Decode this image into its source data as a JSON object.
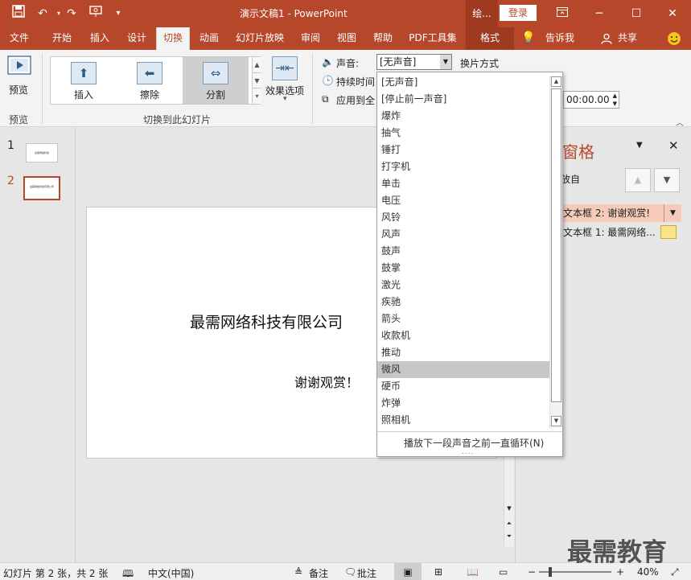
{
  "title_bar": {
    "doc_title": "演示文稿1  -  PowerPoint",
    "context_tab": "绘...",
    "login": "登录"
  },
  "tabs": [
    "文件",
    "开始",
    "插入",
    "设计",
    "切换",
    "动画",
    "幻灯片放映",
    "审阅",
    "视图",
    "帮助",
    "PDF工具集",
    "格式"
  ],
  "tell_me": "告诉我",
  "share": "共享",
  "ribbon": {
    "preview_label": "预览",
    "preview_group": "预览",
    "gallery": [
      "插入",
      "擦除",
      "分割"
    ],
    "gallery_group": "切换到此幻灯片",
    "effect_options": "效果选项",
    "sound_label": "声音:",
    "sound_value": "[无声音]",
    "duration_label": "持续时间",
    "apply_all": "应用到全",
    "advance_label": "换片方式",
    "time_value": "00:00.00"
  },
  "slides": {
    "numbers": [
      "1",
      "2"
    ],
    "thumb1_text": "最需网络科技",
    "thumb2_text": "最需网络科技有限公司"
  },
  "slide": {
    "title": "最需网络科技有限公司",
    "subtitle": "谢谢观赏！"
  },
  "anim_pane": {
    "title": "窗格",
    "play": "放自",
    "item1": "文本框 2: 谢谢观赏!",
    "item2": "文本框 1: 最需网络..."
  },
  "dropdown": {
    "items": [
      "[无声音]",
      "[停止前一声音]",
      "爆炸",
      "抽气",
      "锤打",
      "打字机",
      "单击",
      "电压",
      "风铃",
      "风声",
      "鼓声",
      "鼓掌",
      "激光",
      "疾驰",
      "箭头",
      "收款机",
      "推动",
      "微风",
      "硬币",
      "炸弹",
      "照相机"
    ],
    "highlighted": "微风",
    "loop_label": "播放下一段声音之前一直循环(N)"
  },
  "status": {
    "slide_info": "幻灯片 第 2 张，共 2 张",
    "language": "中文(中国)",
    "notes": "备注",
    "comments": "批注",
    "zoom": "40%"
  },
  "watermark": "最需教育",
  "colors": {
    "accent": "#b7472a",
    "highlight": "#c6c6c6"
  }
}
